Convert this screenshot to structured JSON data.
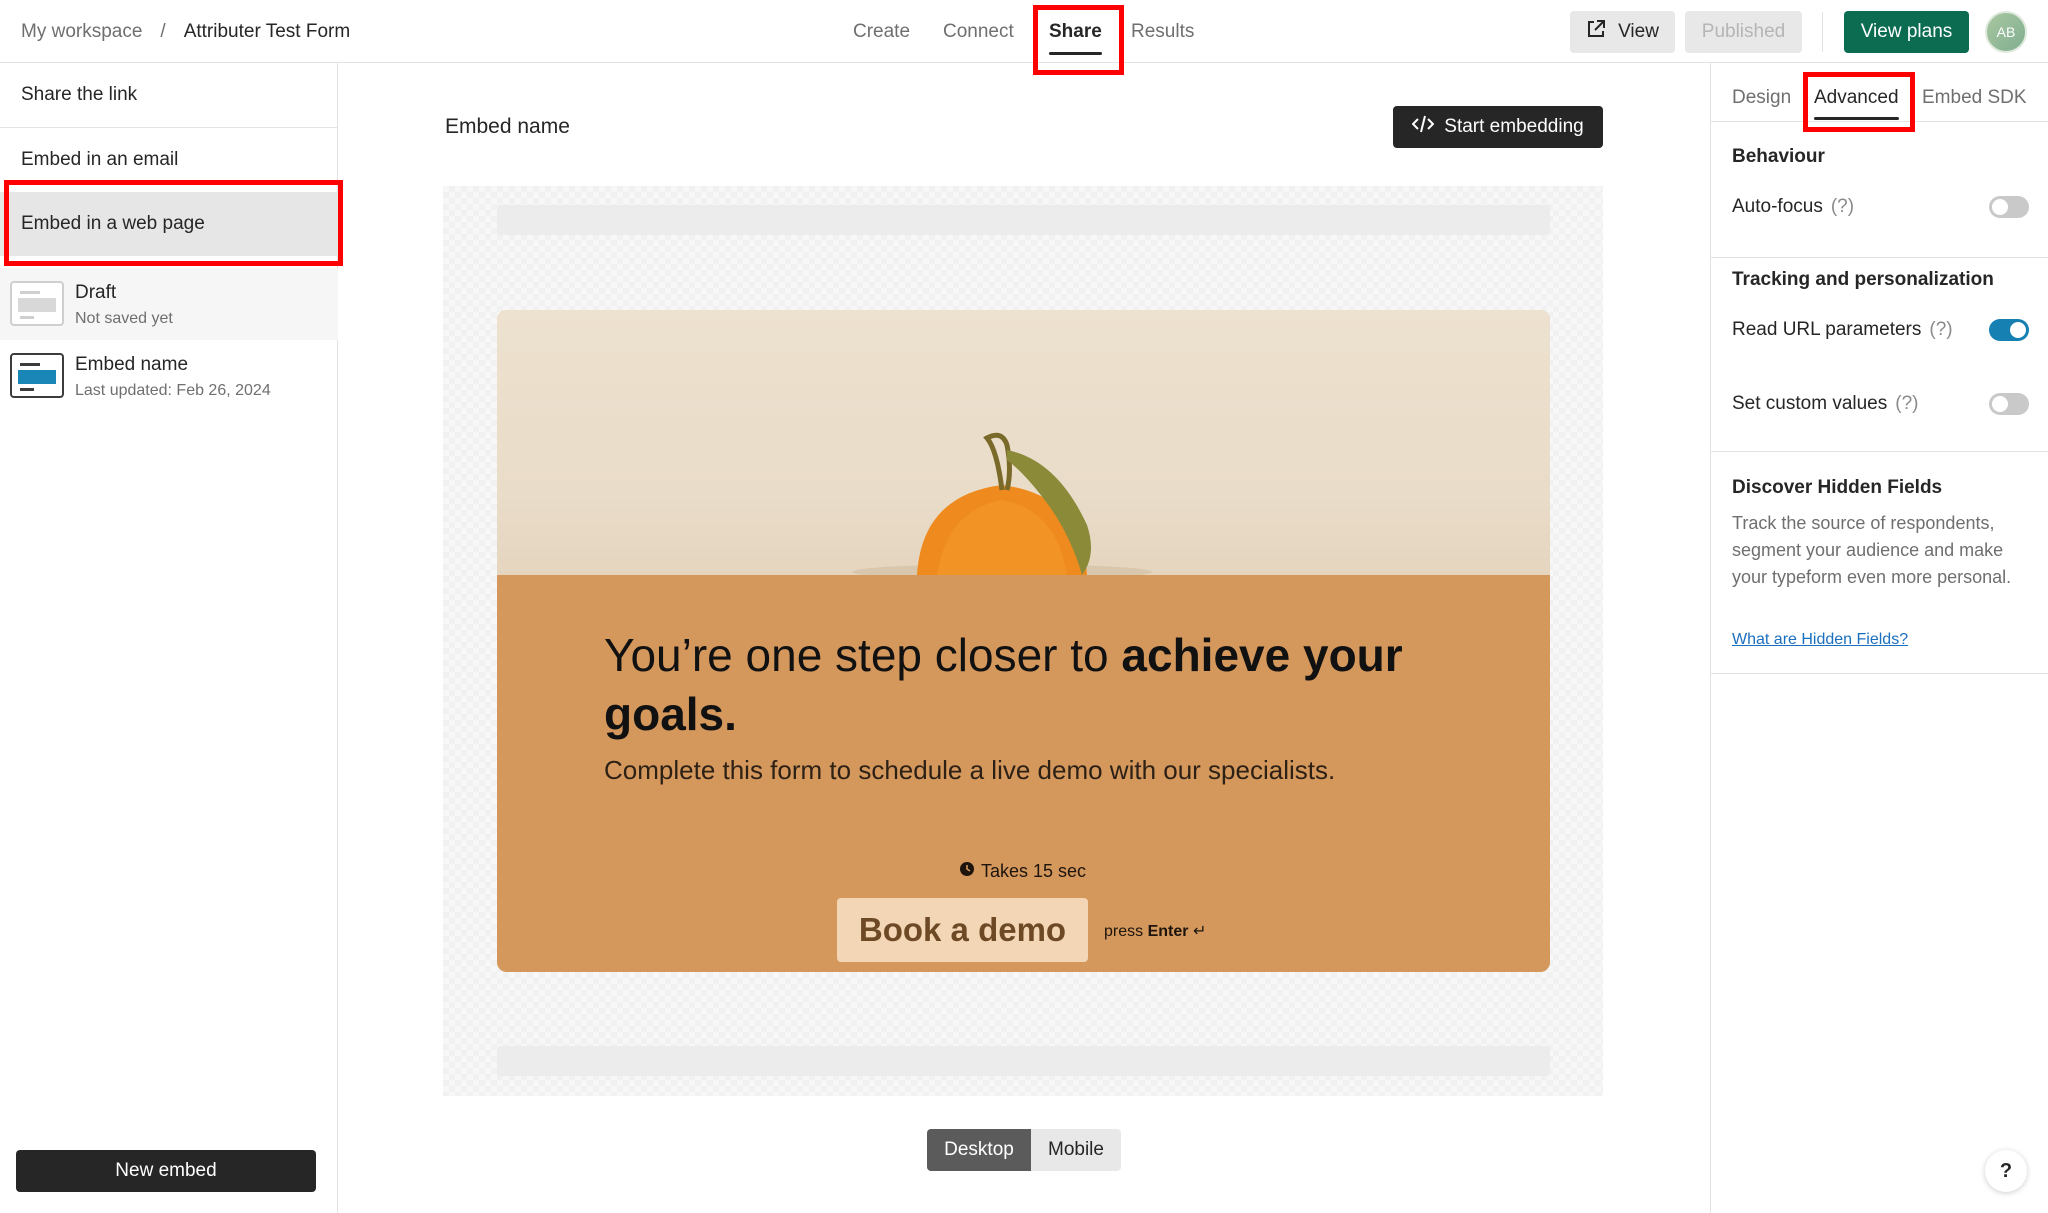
{
  "breadcrumb": {
    "workspace": "My workspace",
    "separator": "/",
    "form": "Attributer Test Form"
  },
  "nav": {
    "tabs": [
      "Create",
      "Connect",
      "Share",
      "Results"
    ],
    "active": "Share"
  },
  "header_actions": {
    "view": "View",
    "published": "Published",
    "plans": "View plans",
    "avatar": "AB"
  },
  "sidebar": {
    "share_link": "Share the link",
    "embed_email": "Embed in an email",
    "embed_web": "Embed in a web page",
    "embeds": [
      {
        "title": "Draft",
        "subtitle": "Not saved yet"
      },
      {
        "title": "Embed name",
        "subtitle": "Last updated: Feb 26, 2024"
      }
    ],
    "new_embed": "New embed"
  },
  "main": {
    "embed_name": "Embed name",
    "start_embedding": "Start embedding",
    "preview": {
      "headline_regular": "You’re one step closer to ",
      "headline_bold": "achieve your goals",
      "headline_end": ".",
      "subline": "Complete this form to schedule a live demo with our specialists.",
      "takes": "Takes 15 sec",
      "button": "Book a demo",
      "press": "press",
      "press_key": "Enter",
      "press_symbol": "↵"
    },
    "device": {
      "desktop": "Desktop",
      "mobile": "Mobile",
      "active": "Desktop"
    }
  },
  "right_panel": {
    "tabs": [
      "Design",
      "Advanced",
      "Embed SDK"
    ],
    "active_tab": "Advanced",
    "behaviour_title": "Behaviour",
    "autofocus": {
      "label": "Auto-focus",
      "hint": "(?)",
      "on": false
    },
    "tracking_title": "Tracking and personalization",
    "read_url": {
      "label": "Read URL parameters",
      "hint": "(?)",
      "on": true
    },
    "custom_values": {
      "label": "Set custom values",
      "hint": "(?)",
      "on": false
    },
    "hidden_title": "Discover Hidden Fields",
    "hidden_desc": "Track the source of respondents, segment your audience and make your typeform even more personal.",
    "hidden_link": "What are Hidden Fields?"
  },
  "help": "?",
  "colors": {
    "accent_green": "#0b6c52",
    "toggle_on": "#1680b3",
    "card_body": "#d5985c",
    "highlight": "#ff0000"
  }
}
